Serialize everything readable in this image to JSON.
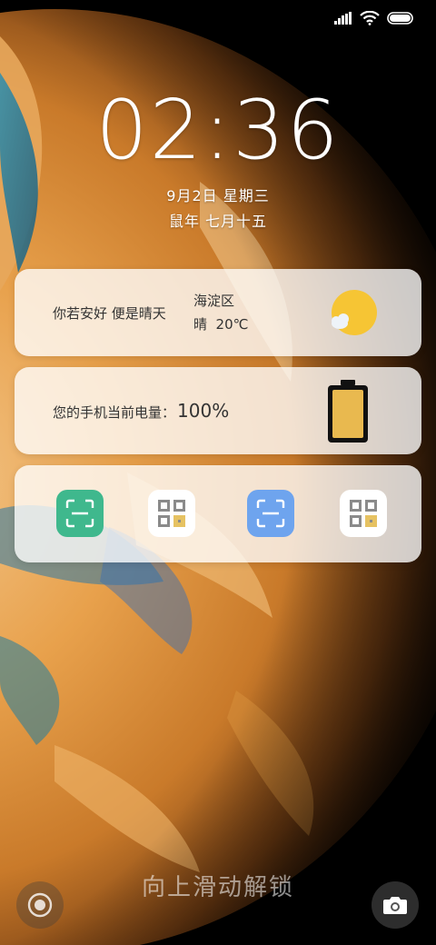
{
  "status_bar": {
    "signal_icon": "signal-bars-icon",
    "wifi_icon": "wifi-icon",
    "battery_icon": "battery-pill-icon"
  },
  "lockscreen": {
    "time": "02:36",
    "date": "9月2日 星期三",
    "lunar_date": "鼠年 七月十五"
  },
  "weather_card": {
    "greeting": "你若安好 便是晴天",
    "district": "海淀区",
    "condition_temp": "晴  20℃",
    "icon": "sun-cloud-icon"
  },
  "battery_card": {
    "label": "您的手机当前电量：",
    "percent": "100%",
    "level": 1.0,
    "icon": "battery-full-icon"
  },
  "shortcuts": [
    {
      "name": "scan-green",
      "icon": "scan-icon",
      "color": "#3fb88d"
    },
    {
      "name": "qr-code-1",
      "icon": "qr-code-icon",
      "color": "#ffffff"
    },
    {
      "name": "scan-blue",
      "icon": "scan-icon",
      "color": "#6ea4ee"
    },
    {
      "name": "qr-code-2",
      "icon": "qr-code-icon",
      "color": "#ffffff"
    }
  ],
  "bottom": {
    "unlock_hint": "向上滑动解锁",
    "left_icon": "assistant-icon",
    "right_icon": "camera-icon"
  },
  "colors": {
    "wallpaper_orange": "#e59a3a",
    "wallpaper_dark": "#000000",
    "card_bg": "#ffffffc7"
  }
}
